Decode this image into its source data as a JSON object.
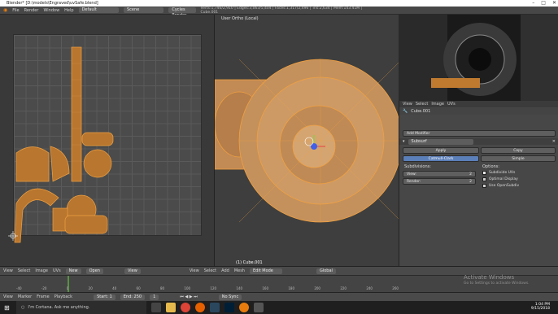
{
  "window": {
    "title": "Blender* [D:\\models\\Engraved\\uvSafe.blend]"
  },
  "infobar": {
    "menus": [
      "File",
      "Render",
      "Window",
      "Help"
    ],
    "layout": "Default",
    "scene": "Scene",
    "engine": "Cycles Render",
    "version": "v2.79",
    "stats": "Verts:1,746/2,910 | Edges:3,063/5,404 | Faces:1,317/2,496 | Tris:2,634 | Mem:143.41M | Cube.001"
  },
  "uv_editor": {
    "header_menus": [
      "View",
      "Select",
      "Image",
      "UVs"
    ],
    "image_field": "New",
    "open_button": "Open",
    "view_field": "View"
  },
  "viewport": {
    "label": "User Ortho (Local)",
    "object_label": "(1) Cube.001",
    "header_menus": [
      "View",
      "Select",
      "Add",
      "Mesh"
    ],
    "mode": "Edit Mode",
    "orientation": "Global"
  },
  "properties": {
    "header_menus": [
      "View",
      "Select",
      "Image",
      "UVs"
    ],
    "object_field": "Cube.001",
    "add_modifier": "Add Modifier",
    "modifier_name": "Subsurf",
    "apply": "Apply",
    "copy": "Copy",
    "algo_catmull": "Catmull-Clark",
    "algo_simple": "Simple",
    "subdivisions_label": "Subdivisions:",
    "view_field": "View:",
    "view_value": "2",
    "render_field": "Render:",
    "render_value": "2",
    "options_label": "Options:",
    "opt_subdivide_uvs": "Subdivide UVs",
    "opt_optimal_display": "Optimal Display",
    "opt_opensubdiv": "Use OpenSubdiv"
  },
  "timeline": {
    "ticks": [
      "-40",
      "-20",
      "0",
      "20",
      "40",
      "60",
      "80",
      "100",
      "120",
      "140",
      "160",
      "180",
      "200",
      "220",
      "240",
      "260"
    ],
    "header_menus": [
      "View",
      "Marker",
      "Frame",
      "Playback"
    ],
    "start_label": "Start:",
    "start_value": "1",
    "end_label": "End:",
    "end_value": "250",
    "current_frame": "1",
    "sync": "No Sync"
  },
  "taskbar": {
    "search_placeholder": "I'm Cortana. Ask me anything.",
    "time": "1:04 PM",
    "date": "9/15/2018"
  },
  "watermark": {
    "line1": "Activate Windows",
    "line2": "Go to Settings to activate Windows."
  },
  "colors": {
    "accent": "#5b7fb9",
    "mesh": "#d4853a",
    "edge": "#f0a040"
  }
}
